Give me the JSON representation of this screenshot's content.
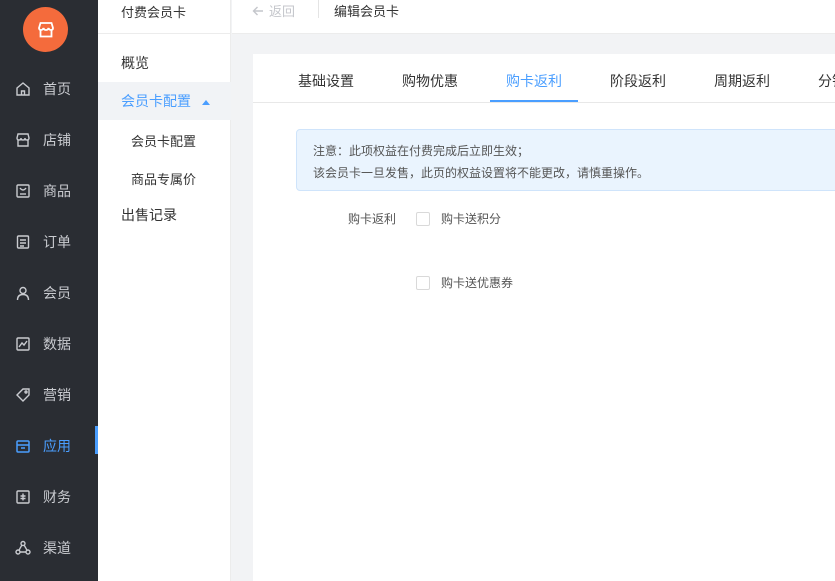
{
  "nav": {
    "items": [
      {
        "label": "首页",
        "icon": "home-icon"
      },
      {
        "label": "店铺",
        "icon": "shop-icon"
      },
      {
        "label": "商品",
        "icon": "goods-icon"
      },
      {
        "label": "订单",
        "icon": "order-icon"
      },
      {
        "label": "会员",
        "icon": "member-icon"
      },
      {
        "label": "数据",
        "icon": "chart-icon"
      },
      {
        "label": "营销",
        "icon": "tag-icon"
      },
      {
        "label": "应用",
        "icon": "app-icon"
      },
      {
        "label": "财务",
        "icon": "finance-icon"
      },
      {
        "label": "渠道",
        "icon": "channel-icon"
      }
    ],
    "active": "应用",
    "logo_icon": "store-logo-icon",
    "logo_color": "#f46b3c"
  },
  "sub": {
    "title": "付费会员卡",
    "items": [
      {
        "label": "概览"
      },
      {
        "label": "会员卡配置"
      },
      {
        "label": "会员卡配置"
      },
      {
        "label": "商品专属价"
      },
      {
        "label": "出售记录"
      }
    ]
  },
  "topbar": {
    "back_label": "返回",
    "crumb": "编辑会员卡"
  },
  "tabs": [
    {
      "label": "基础设置"
    },
    {
      "label": "购物优惠"
    },
    {
      "label": "购卡返利"
    },
    {
      "label": "阶段返利"
    },
    {
      "label": "周期返利"
    },
    {
      "label": "分销"
    }
  ],
  "active_tab": "购卡返利",
  "notice": {
    "line1": "注意：此项权益在付费完成后立即生效；",
    "line2": "该会员卡一旦发售，此页的权益设置将不能更改，请慎重操作。"
  },
  "form": {
    "label": "购卡返利",
    "options": [
      {
        "label": "购卡送积分",
        "checked": false
      },
      {
        "label": "购卡送优惠券",
        "checked": false
      }
    ]
  },
  "colors": {
    "accent": "#4a9eff",
    "nav_bg": "#2a2d33"
  }
}
